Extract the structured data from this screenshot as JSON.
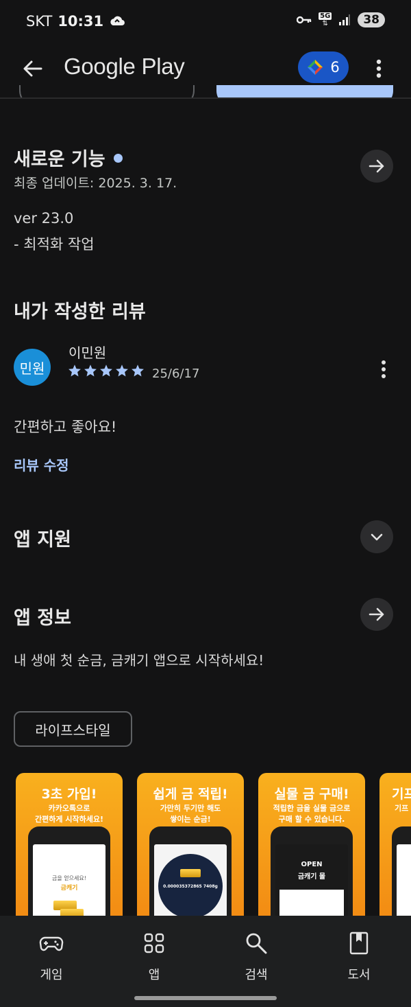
{
  "status_bar": {
    "carrier": "SKT",
    "time": "10:31",
    "network": "5G",
    "battery": "38"
  },
  "app_bar": {
    "brand": "Google Play",
    "points": "6"
  },
  "whats_new": {
    "title": "새로운 기능",
    "updated": "최종 업데이트: 2025. 3. 17.",
    "version": "ver 23.0",
    "notes": "- 최적화 작업"
  },
  "my_review": {
    "title": "내가 작성한 리뷰",
    "avatar_text": "민원",
    "reviewer": "이민원",
    "rating": 5,
    "date": "25/6/17",
    "text": "간편하고 좋아요!",
    "edit_label": "리뷰 수정"
  },
  "app_support": {
    "title": "앱 지원"
  },
  "about_app": {
    "title": "앱 정보",
    "description": "내 생애 첫 순금, 금캐기 앱으로 시작하세요!",
    "category_chip": "라이프스타일"
  },
  "screenshots": [
    {
      "title": "3초 가입!",
      "subtitle_1": "카카오톡으로",
      "subtitle_2": "간편하게 시작하세요!",
      "screen_line_1": "금을 얻으세요!",
      "screen_line_2": "금캐기"
    },
    {
      "title": "쉽게 금 적립!",
      "subtitle_1": "가만히 두기만 해도",
      "subtitle_2": "쌓이는 순금!",
      "screen_line_1": "0.000035372865 7408g",
      "screen_line_2": ""
    },
    {
      "title": "실물 금 구매!",
      "subtitle_1": "적립한 금을 실물 금으로",
      "subtitle_2": "구매 할 수 있습니다.",
      "screen_line_1": "OPEN",
      "screen_line_2": "금캐기 몰"
    },
    {
      "title": "기프",
      "subtitle_1": "",
      "subtitle_2": "기프",
      "screen_line_1": "",
      "screen_line_2": ""
    }
  ],
  "bottom_nav": [
    {
      "label": "게임",
      "icon": "gamepad-icon"
    },
    {
      "label": "앱",
      "icon": "apps-grid-icon"
    },
    {
      "label": "검색",
      "icon": "search-icon"
    },
    {
      "label": "도서",
      "icon": "book-icon"
    }
  ],
  "colors": {
    "background": "#131314",
    "accent": "#a8c7fa",
    "star": "#a8c7fa",
    "points_badge": "#1a56c6",
    "screenshot_orange": "#f59e18"
  }
}
